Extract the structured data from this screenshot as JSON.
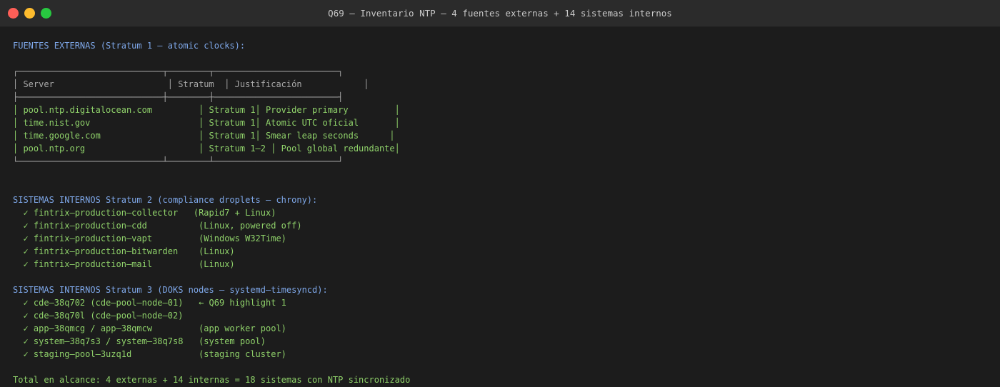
{
  "window": {
    "title": "Q69 — Inventario NTP — 4 fuentes externas + 14 sistemas internos"
  },
  "external": {
    "heading": "FUENTES EXTERNAS (Stratum 1 — atomic clocks):",
    "table": {
      "top_border": "┌────────────────────────────┬────────┬────────────────────────┐",
      "header_row": "│ Server                      │ Stratum  │ Justificación            │",
      "mid_border": "├────────────────────────────┼────────┼────────────────────────┤",
      "rows": [
        "│ pool.ntp.digitalocean.com         │ Stratum 1│ Provider primary         │",
        "│ time.nist.gov                     │ Stratum 1│ Atomic UTC oficial       │",
        "│ time.google.com                   │ Stratum 1│ Smear leap seconds      │",
        "│ pool.ntp.org                      │ Stratum 1–2 │ Pool global redundante│"
      ],
      "bottom_border": "└────────────────────────────┴────────┴────────────────────────┘"
    }
  },
  "stratum2": {
    "heading": "SISTEMAS INTERNOS Stratum 2 (compliance droplets — chrony):",
    "items": [
      "  ✓ fintrix–production–collector   (Rapid7 + Linux)",
      "  ✓ fintrix–production–cdd          (Linux, powered off)",
      "  ✓ fintrix–production–vapt         (Windows W32Time)",
      "  ✓ fintrix–production–bitwarden    (Linux)",
      "  ✓ fintrix–production–mail         (Linux)"
    ]
  },
  "stratum3": {
    "heading": "SISTEMAS INTERNOS Stratum 3 (DOKS nodes — systemd–timesyncd):",
    "items": [
      "  ✓ cde–38q702 (cde–pool–node–01)   ← Q69 highlight 1",
      "  ✓ cde–38q70l (cde–pool–node–02)",
      "  ✓ app–38qmcg / app–38qmcw         (app worker pool)",
      "  ✓ system–38q7s3 / system–38q7s8   (system pool)",
      "  ✓ staging–pool–3uzq1d             (staging cluster)"
    ]
  },
  "total": "Total en alcance: 4 externas + 14 internas = 18 sistemas con NTP sincronizado"
}
